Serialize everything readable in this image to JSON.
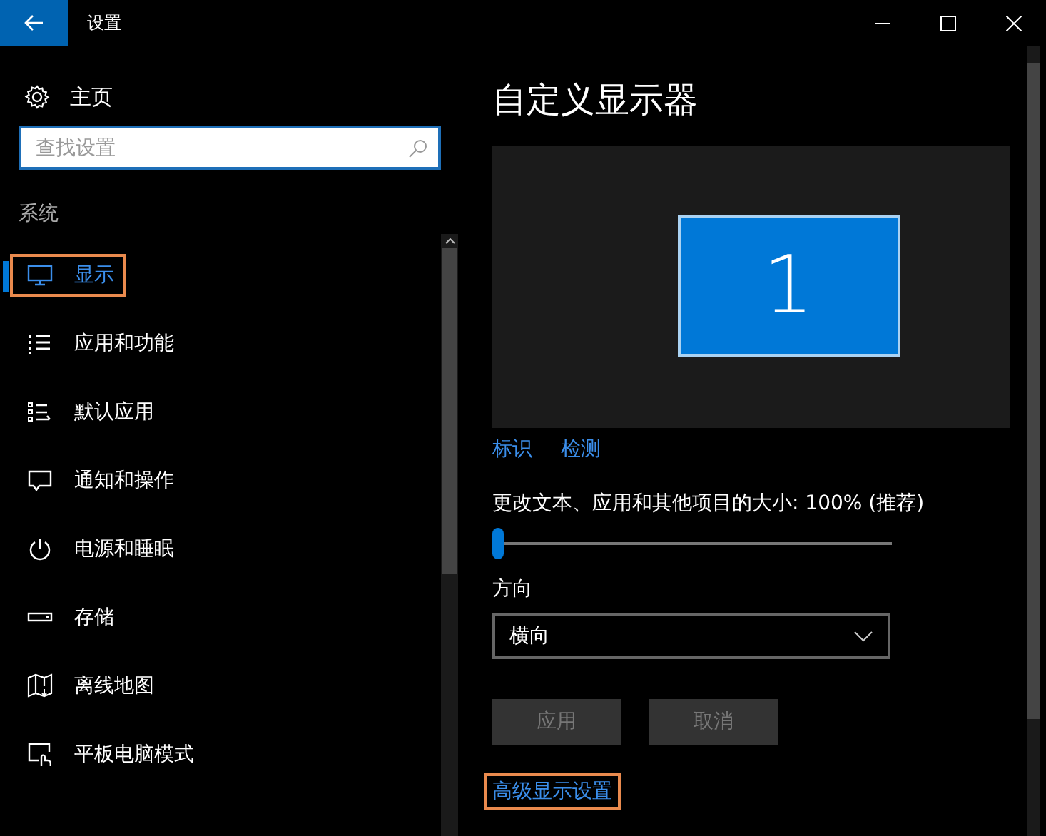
{
  "window": {
    "title": "设置"
  },
  "sidebar": {
    "home": "主页",
    "search": {
      "placeholder": "查找设置"
    },
    "section": "系统",
    "items": [
      {
        "label": "显示",
        "selected": true,
        "highlighted": true
      },
      {
        "label": "应用和功能",
        "selected": false,
        "highlighted": false
      },
      {
        "label": "默认应用",
        "selected": false,
        "highlighted": false
      },
      {
        "label": "通知和操作",
        "selected": false,
        "highlighted": false
      },
      {
        "label": "电源和睡眠",
        "selected": false,
        "highlighted": false
      },
      {
        "label": "存储",
        "selected": false,
        "highlighted": false
      },
      {
        "label": "离线地图",
        "selected": false,
        "highlighted": false
      },
      {
        "label": "平板电脑模式",
        "selected": false,
        "highlighted": false
      }
    ]
  },
  "content": {
    "title": "自定义显示器",
    "monitor_number": "1",
    "links": [
      "标识",
      "检测"
    ],
    "scale": {
      "label": "更改文本、应用和其他项目的大小: 100% (推荐)",
      "level": 0
    },
    "orientation": {
      "label": "方向",
      "value": "横向"
    },
    "buttons": [
      {
        "label": "应用",
        "disabled": true
      },
      {
        "label": "取消",
        "disabled": true
      }
    ],
    "advanced_link": {
      "label": "高级显示设置",
      "highlighted": true
    }
  }
}
